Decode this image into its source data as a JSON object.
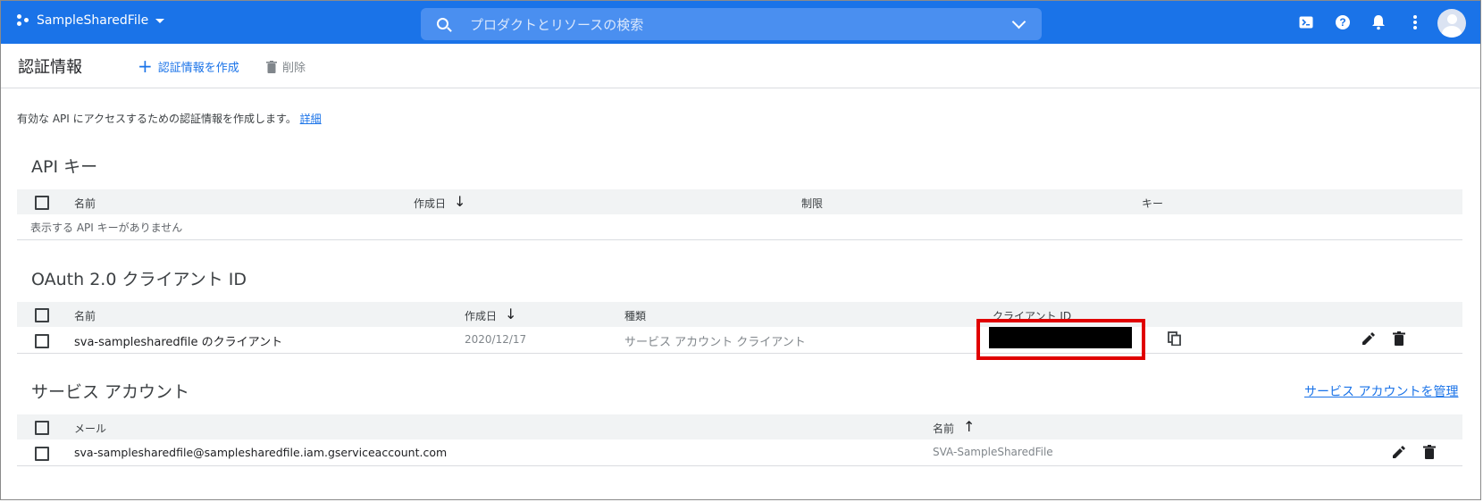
{
  "topbar": {
    "project_name": "SampleSharedFile",
    "search_placeholder": "プロダクトとリソースの検索",
    "icons": [
      "terminal-icon",
      "help-icon",
      "notifications-icon",
      "more-vert-icon",
      "account-avatar"
    ],
    "bg_color": "#1a73e8"
  },
  "header": {
    "title": "認証情報",
    "create_label": "認証情報を作成",
    "delete_label": "削除"
  },
  "intro": {
    "text": "有効な API にアクセスするための認証情報を作成します。",
    "link": "詳細"
  },
  "api_keys": {
    "title": "API キー",
    "columns": [
      "名前",
      "作成日",
      "制限",
      "キー"
    ],
    "empty_message": "表示する API キーがありません"
  },
  "oauth": {
    "title": "OAuth 2.0 クライアント ID",
    "columns": [
      "名前",
      "作成日",
      "種類",
      "クライアント ID"
    ],
    "rows": [
      {
        "name": "sva-samplesharedfile のクライアント",
        "created": "2020/12/17",
        "type": "サービス アカウント クライアント"
      }
    ]
  },
  "service_accounts": {
    "title": "サービス アカウント",
    "manage_link": "サービス アカウントを管理",
    "columns": [
      "メール",
      "名前"
    ],
    "rows": [
      {
        "email": "sva-samplesharedfile@samplesharedfile.iam.gserviceaccount.com",
        "name": "SVA-SampleSharedFile"
      }
    ]
  },
  "colors": {
    "accent": "#1a73e8",
    "highlight_box": "#e00000"
  }
}
